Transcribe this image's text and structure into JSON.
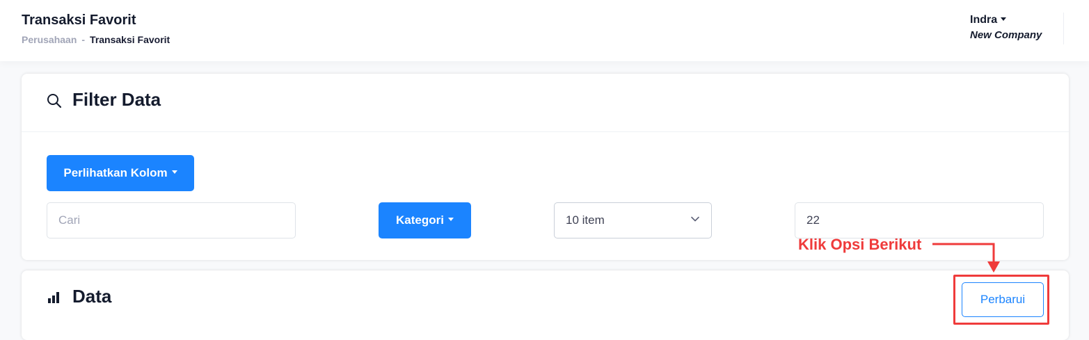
{
  "header": {
    "title": "Transaksi Favorit",
    "breadcrumb": {
      "parent": "Perusahaan",
      "separator": "-",
      "current": "Transaksi Favorit"
    },
    "user": {
      "name": "Indra",
      "company": "New Company"
    }
  },
  "filter": {
    "title": "Filter Data",
    "columns_button": "Perlihatkan Kolom",
    "search_placeholder": "Cari",
    "category_button": "Kategori",
    "page_size": "10 item",
    "number_value": "22"
  },
  "data_section": {
    "title": "Data",
    "refresh_button": "Perbarui"
  },
  "annotation": {
    "text": "Klik Opsi Berikut",
    "color": "#ef3b3b"
  },
  "colors": {
    "primary": "#1b84ff",
    "annotation": "#ef3b3b"
  }
}
